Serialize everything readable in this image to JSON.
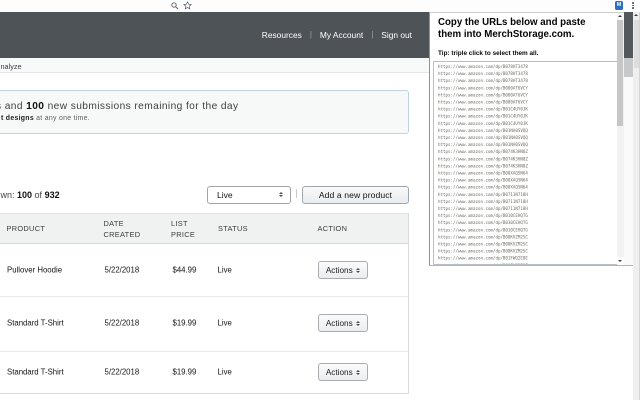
{
  "colors": {
    "header_bg": "#4e5357",
    "extension_icon_bg": "#2e6fbd",
    "notice_border": "#bfd5dd"
  },
  "browser": {
    "extension_icon_label": "M"
  },
  "site_header": {
    "links": {
      "resources": "Resources",
      "my_account": "My Account",
      "sign_out": "Sign out"
    },
    "separator": "|"
  },
  "tab_bar": {
    "visible_tab_label": "nalyze"
  },
  "notice": {
    "line1_prefix": "s and ",
    "line1_count": "100",
    "line1_suffix": " new submissions remaining for the day",
    "line2_bold": "t designs",
    "line2_rest": " at any one time."
  },
  "controls": {
    "shown_prefix": "wn: ",
    "shown_count": "100",
    "shown_connector": " of ",
    "shown_total": "932",
    "filter_value": "Live",
    "add_button_label": "Add a new product"
  },
  "table": {
    "headers": {
      "product": "PRODUCT",
      "date_line1": "DATE",
      "date_line2": "CREATED",
      "price_line1": "LIST",
      "price_line2": "PRICE",
      "status": "STATUS",
      "action": "ACTION"
    },
    "rows": [
      {
        "product": "Pullover Hoodie",
        "date": "5/22/2018",
        "price": "$44.99",
        "status": "Live",
        "action_label": "Actions"
      },
      {
        "product": "Standard T-Shirt",
        "date": "5/22/2018",
        "price": "$19.99",
        "status": "Live",
        "action_label": "Actions"
      },
      {
        "product": "Standard T-Shirt",
        "date": "5/22/2018",
        "price": "$19.99",
        "status": "Live",
        "action_label": "Actions"
      }
    ]
  },
  "popup": {
    "title_line1": "Copy the URLs below and paste",
    "title_line2": "them into MerchStorage.com.",
    "tip": "Tip: triple click to select them all.",
    "urls": [
      "https://www.amazon.com/dp/B078HT3478",
      "https://www.amazon.com/dp/B078HT3478",
      "https://www.amazon.com/dp/B078HT3478",
      "https://www.amazon.com/dp/B000AT6VCY",
      "https://www.amazon.com/dp/B000AT6VCY",
      "https://www.amazon.com/dp/B000AT6VCY",
      "https://www.amazon.com/dp/B01C4UY0JK",
      "https://www.amazon.com/dp/B01C4UY0JK",
      "https://www.amazon.com/dp/B01C4UY0JK",
      "https://www.amazon.com/dp/B01NA0SVQQ",
      "https://www.amazon.com/dp/B01NA0SVQQ",
      "https://www.amazon.com/dp/B01NA0SVQQ",
      "https://www.amazon.com/dp/B074K3HN0Z",
      "https://www.amazon.com/dp/B074K3HN0Z",
      "https://www.amazon.com/dp/B074K3HN0Z",
      "https://www.amazon.com/dp/B00XAQSN64",
      "https://www.amazon.com/dp/B00XAQSN64",
      "https://www.amazon.com/dp/B00XAQSN64",
      "https://www.amazon.com/dp/B0711N718H",
      "https://www.amazon.com/dp/B0711N718H",
      "https://www.amazon.com/dp/B0711N718H",
      "https://www.amazon.com/dp/B010CEHQTG",
      "https://www.amazon.com/dp/B010CEHQTG",
      "https://www.amazon.com/dp/B010CEHQTG",
      "https://www.amazon.com/dp/B00KVZM2SC",
      "https://www.amazon.com/dp/B00KVZM2SC",
      "https://www.amazon.com/dp/B00KVZM2SC",
      "https://www.amazon.com/dp/B01FWO2E8E",
      "https://www.amazon.com/dp/B01FWO2E8E",
      "https://www.amazon.com/dp/B01FWO2E8E"
    ]
  }
}
